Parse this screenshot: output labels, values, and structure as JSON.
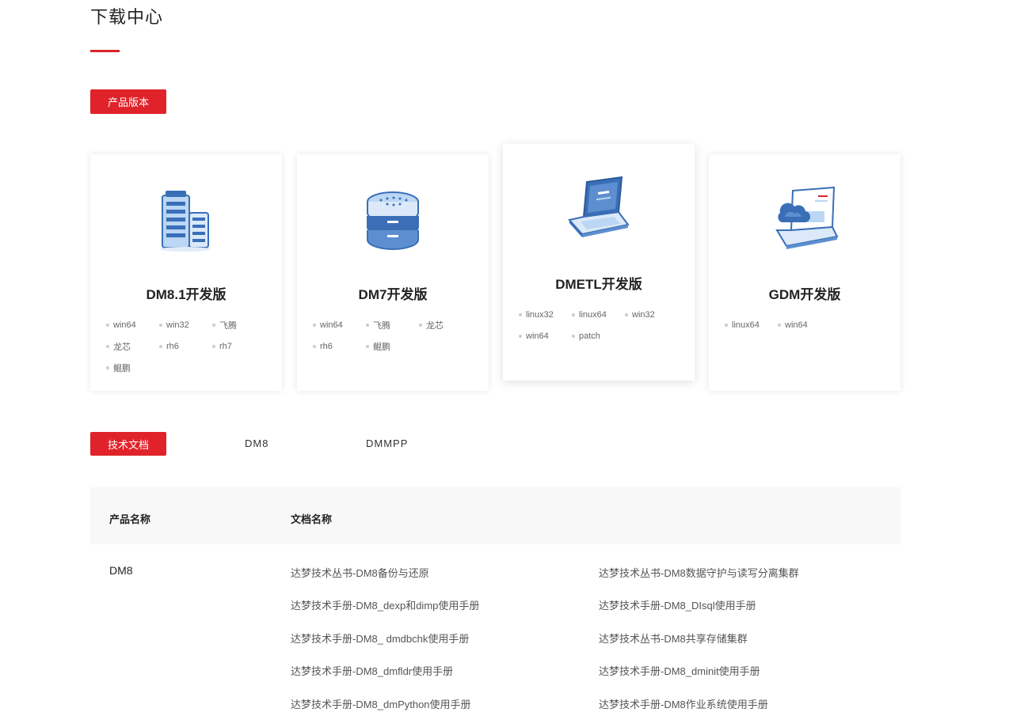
{
  "page": {
    "title": "下载中心"
  },
  "versions": {
    "tag_label": "产品版本",
    "cards": [
      {
        "title": "DM8.1开发版",
        "icon": "server-tower-icon",
        "links": [
          "win64",
          "win32",
          "飞腾",
          "龙芯",
          "rh6",
          "rh7",
          "鲲鹏"
        ]
      },
      {
        "title": "DM7开发版",
        "icon": "server-stack-icon",
        "links": [
          "win64",
          "飞腾",
          "龙芯",
          "rh6",
          "鲲鹏"
        ]
      },
      {
        "title": "DMETL开发版",
        "icon": "laptop-icon",
        "links": [
          "linux32",
          "linux64",
          "win32",
          "win64",
          "patch"
        ]
      },
      {
        "title": "GDM开发版",
        "icon": "cloud-laptop-icon",
        "links": [
          "linux64",
          "win64"
        ]
      }
    ]
  },
  "docs": {
    "tag_label": "技术文档",
    "tabs": [
      "DM8",
      "DMMPP"
    ],
    "header": {
      "product": "产品名称",
      "document": "文档名称"
    },
    "product": "DM8",
    "col1": [
      "达梦技术丛书-DM8备份与还原",
      "达梦技术手册-DM8_dexp和dimp使用手册",
      "达梦技术手册-DM8_ dmdbchk使用手册",
      "达梦技术手册-DM8_dmfldr使用手册",
      "达梦技术手册-DM8_dmPython使用手册"
    ],
    "col2": [
      "达梦技术丛书-DM8数据守护与读写分离集群",
      "达梦技术手册-DM8_DIsql使用手册",
      "达梦技术丛书-DM8共享存储集群",
      "达梦技术手册-DM8_dminit使用手册",
      "达梦技术手册-DM8作业系统使用手册"
    ]
  },
  "colors": {
    "accent": "#e0232a",
    "icon_blue": "#3a6fb8",
    "icon_light": "#bcd7f3"
  }
}
